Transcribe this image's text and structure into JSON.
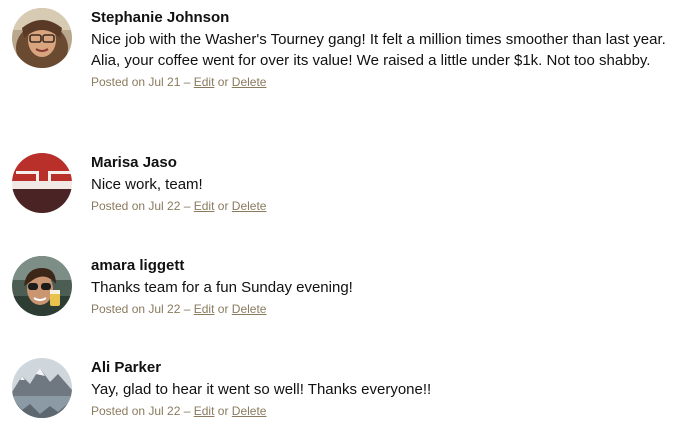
{
  "comments": [
    {
      "author": "Stephanie Johnson",
      "text": "Nice job with the Washer's Tourney gang! It felt a million times smoother than last year. Alia, your coffee went for over its value! We raised a little under $1k. Not too shabby.",
      "posted": "Posted on Jul 21 –",
      "edit_label": "Edit",
      "or_label": "or",
      "delete_label": "Delete"
    },
    {
      "author": "Marisa Jaso",
      "text": "Nice work, team!",
      "posted": "Posted on Jul 22 –",
      "edit_label": "Edit",
      "or_label": "or",
      "delete_label": "Delete"
    },
    {
      "author": "amara liggett",
      "text": "Thanks team for a fun Sunday evening!",
      "posted": "Posted on Jul 22 –",
      "edit_label": "Edit",
      "or_label": "or",
      "delete_label": "Delete"
    },
    {
      "author": "Ali Parker",
      "text": "Yay, glad to hear it went so well! Thanks everyone!!",
      "posted": "Posted on Jul 22 –",
      "edit_label": "Edit",
      "or_label": "or",
      "delete_label": "Delete"
    }
  ],
  "colors": {
    "meta_text": "#8a7a5e",
    "body_text": "#111111"
  }
}
